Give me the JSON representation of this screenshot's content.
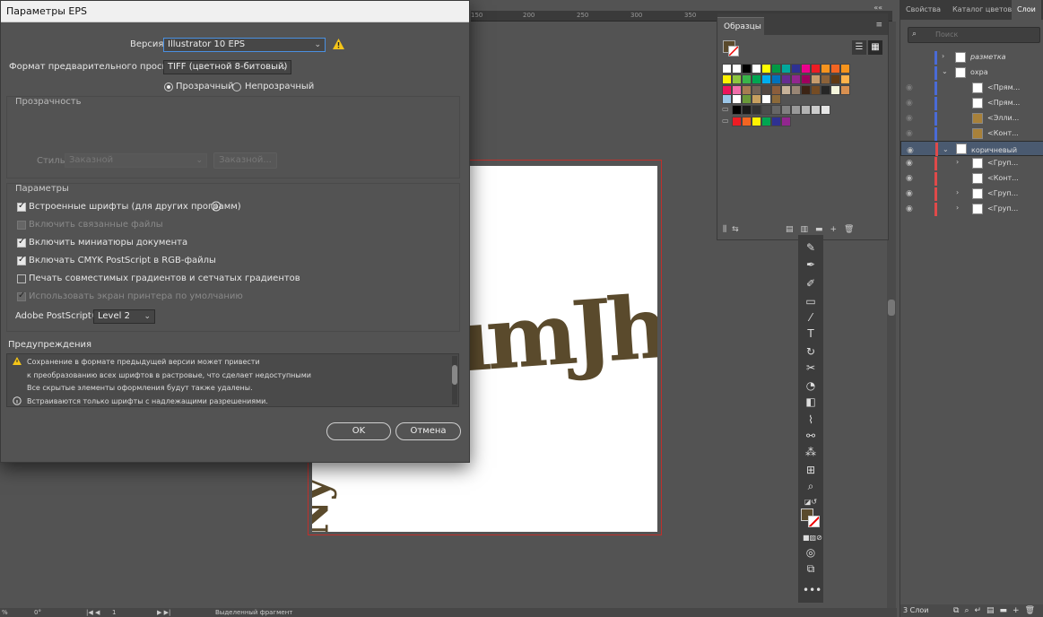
{
  "dialog": {
    "title": "Параметры EPS",
    "version_label": "Версия:",
    "version_value": "Illustrator 10 EPS",
    "preview_label": "Формат предварительного просмотра:",
    "preview_value": "TIFF (цветной 8-битовый)",
    "radio_transparent": "Прозрачный",
    "radio_opaque": "Непрозрачный",
    "transparency_group": "Прозрачность",
    "style_label": "Стиль:",
    "style_value": "Заказной",
    "custom_button": "Заказной...",
    "params_group": "Параметры",
    "options": [
      {
        "label": "Встроенные шрифты (для других программ)",
        "checked": true,
        "disabled": false
      },
      {
        "label": "Включить связанные файлы",
        "checked": false,
        "disabled": true
      },
      {
        "label": "Включить миниатюры документа",
        "checked": true,
        "disabled": false
      },
      {
        "label": "Включать CMYK PostScript в RGB-файлы",
        "checked": true,
        "disabled": false
      },
      {
        "label": "Печать совместимых градиентов и сетчатых градиентов",
        "checked": false,
        "disabled": false
      },
      {
        "label": "Использовать экран принтера по умолчанию",
        "checked": true,
        "disabled": true
      }
    ],
    "postscript_label": "Adobe PostScript®:",
    "postscript_value": "Level 2",
    "warnings_title": "Предупреждения",
    "warnings": [
      "Сохранение в формате предыдущей версии может привести",
      "к преобразованию всех шрифтов в растровые, что сделает недоступными",
      "Все скрытые элементы оформления будут также удалены.",
      "Встраиваются только шрифты с надлежащими разрешениями."
    ],
    "ok": "OK",
    "cancel": "Отмена"
  },
  "ruler": {
    "ticks": [
      "150",
      "200",
      "250",
      "300",
      "350"
    ]
  },
  "artwork": {
    "main": "umJhus",
    "side": "Ny"
  },
  "swatches": {
    "tab": "Образцы",
    "rows": [
      [
        "#ffffff",
        "#ffffff",
        "#000000",
        "#ffffff",
        "#ffff00",
        "#009944",
        "#00a99d",
        "#2e3192",
        "#ec008c",
        "#ed1c24",
        "#f7931e",
        "#f26522",
        "#f7941d"
      ],
      [
        "#fff200",
        "#8dc63f",
        "#39b54a",
        "#00a651",
        "#00aeef",
        "#0072bc",
        "#662d91",
        "#92278f",
        "#9e005d",
        "#c69c6d",
        "#8c6239",
        "#603913",
        "#ffb24a"
      ],
      [
        "#ed145b",
        "#f06eaa",
        "#a67c52",
        "#736357",
        "#534741",
        "#8b5e3c",
        "#c7b299",
        "#998675",
        "#3c2415",
        "#754c24",
        "#262626",
        "#f5f5dc",
        "#d99050"
      ],
      [
        "#9bc6e8",
        "#ffffff",
        "#6a9a3a",
        "#c8a060",
        "#ffffff",
        "#8c6a3a"
      ],
      [
        "#000000",
        "#1a1a1a",
        "#333333",
        "#4d4d4d",
        "#666666",
        "#808080",
        "#999999",
        "#b3b3b3",
        "#cccccc",
        "#e6e6e6"
      ],
      [
        "#ed1c24",
        "#f26522",
        "#fff200",
        "#00a651",
        "#2e3192",
        "#92278f"
      ]
    ]
  },
  "layers": {
    "tabs": [
      "Свойства",
      "Каталог цветов",
      "Слои"
    ],
    "search_placeholder": "Поиск",
    "rows": [
      {
        "name": "разметка",
        "color": "#4a6bd6"
      },
      {
        "name": "охра",
        "color": "#4a6bd6"
      },
      {
        "name": "<Прям...",
        "color": "#4a6bd6"
      },
      {
        "name": "<Прям...",
        "color": "#4a6bd6"
      },
      {
        "name": "<Элли...",
        "color": "#4a6bd6"
      },
      {
        "name": "<Конт...",
        "color": "#4a6bd6"
      },
      {
        "name": "коричневый",
        "color": "#e04a4a"
      },
      {
        "name": "<Груп...",
        "color": "#e04a4a"
      },
      {
        "name": "<Конт...",
        "color": "#e04a4a"
      },
      {
        "name": "<Груп...",
        "color": "#e04a4a"
      },
      {
        "name": "<Груп...",
        "color": "#e04a4a"
      }
    ],
    "count": "3 Слои"
  },
  "status": {
    "zoom": "%",
    "angle": "0°",
    "page": "1",
    "selection": "Выделенный фрагмент"
  }
}
